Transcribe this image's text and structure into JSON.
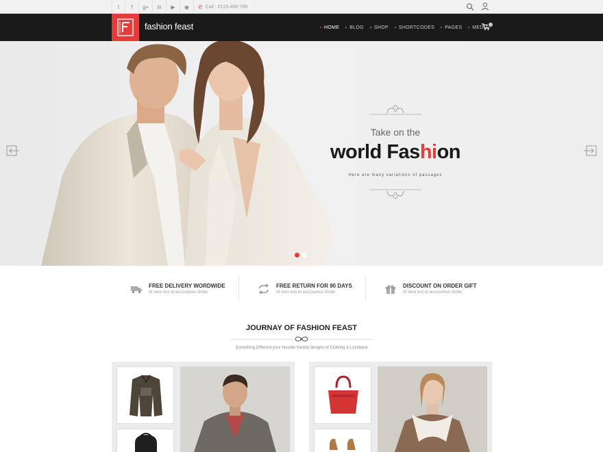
{
  "topbar": {
    "social_icons": [
      "twitter-icon",
      "facebook-icon",
      "google-plus-icon",
      "linkedin-icon",
      "youtube-icon",
      "rss-icon"
    ],
    "social_glyphs": [
      "t",
      "f",
      "g+",
      "in",
      "▶",
      "◉"
    ],
    "phone_text": "Call : 0123-456-789"
  },
  "header": {
    "logo_letter": "F",
    "logo_text": "fashion feast",
    "nav": [
      "HOME",
      "BLOG",
      "SHOP",
      "SHORTCODES",
      "PAGES",
      "MEDIA"
    ],
    "active_index": 0
  },
  "hero": {
    "subtitle": "Take on the",
    "title_part1": "world Fas",
    "title_highlight": "hi",
    "title_part2": "on",
    "tagline": "Here are many variations of passages",
    "slide_count": 2,
    "active_slide": 0
  },
  "features": [
    {
      "icon": "truck-icon",
      "title": "FREE DELIVERY WORDWIDE",
      "text": "At vero eos et accusamus Order."
    },
    {
      "icon": "return-arrows-icon",
      "title": "FREE RETURN FOR 90 DAYS",
      "text": "At vero eos et accusamus Order."
    },
    {
      "icon": "gift-icon",
      "title": "DISCOUNT ON ORDER GIFT",
      "text": "At vero eos et accusamus Order."
    }
  ],
  "section": {
    "title": "JOURNAY OF FASHION FEAST",
    "subtitle": "Something Different your favorite Variety designs of Clothing & Lockbook"
  },
  "colors": {
    "accent": "#e43b3b",
    "header_bg": "#1a1a1a",
    "topbar_bg": "#f1f1f1"
  }
}
